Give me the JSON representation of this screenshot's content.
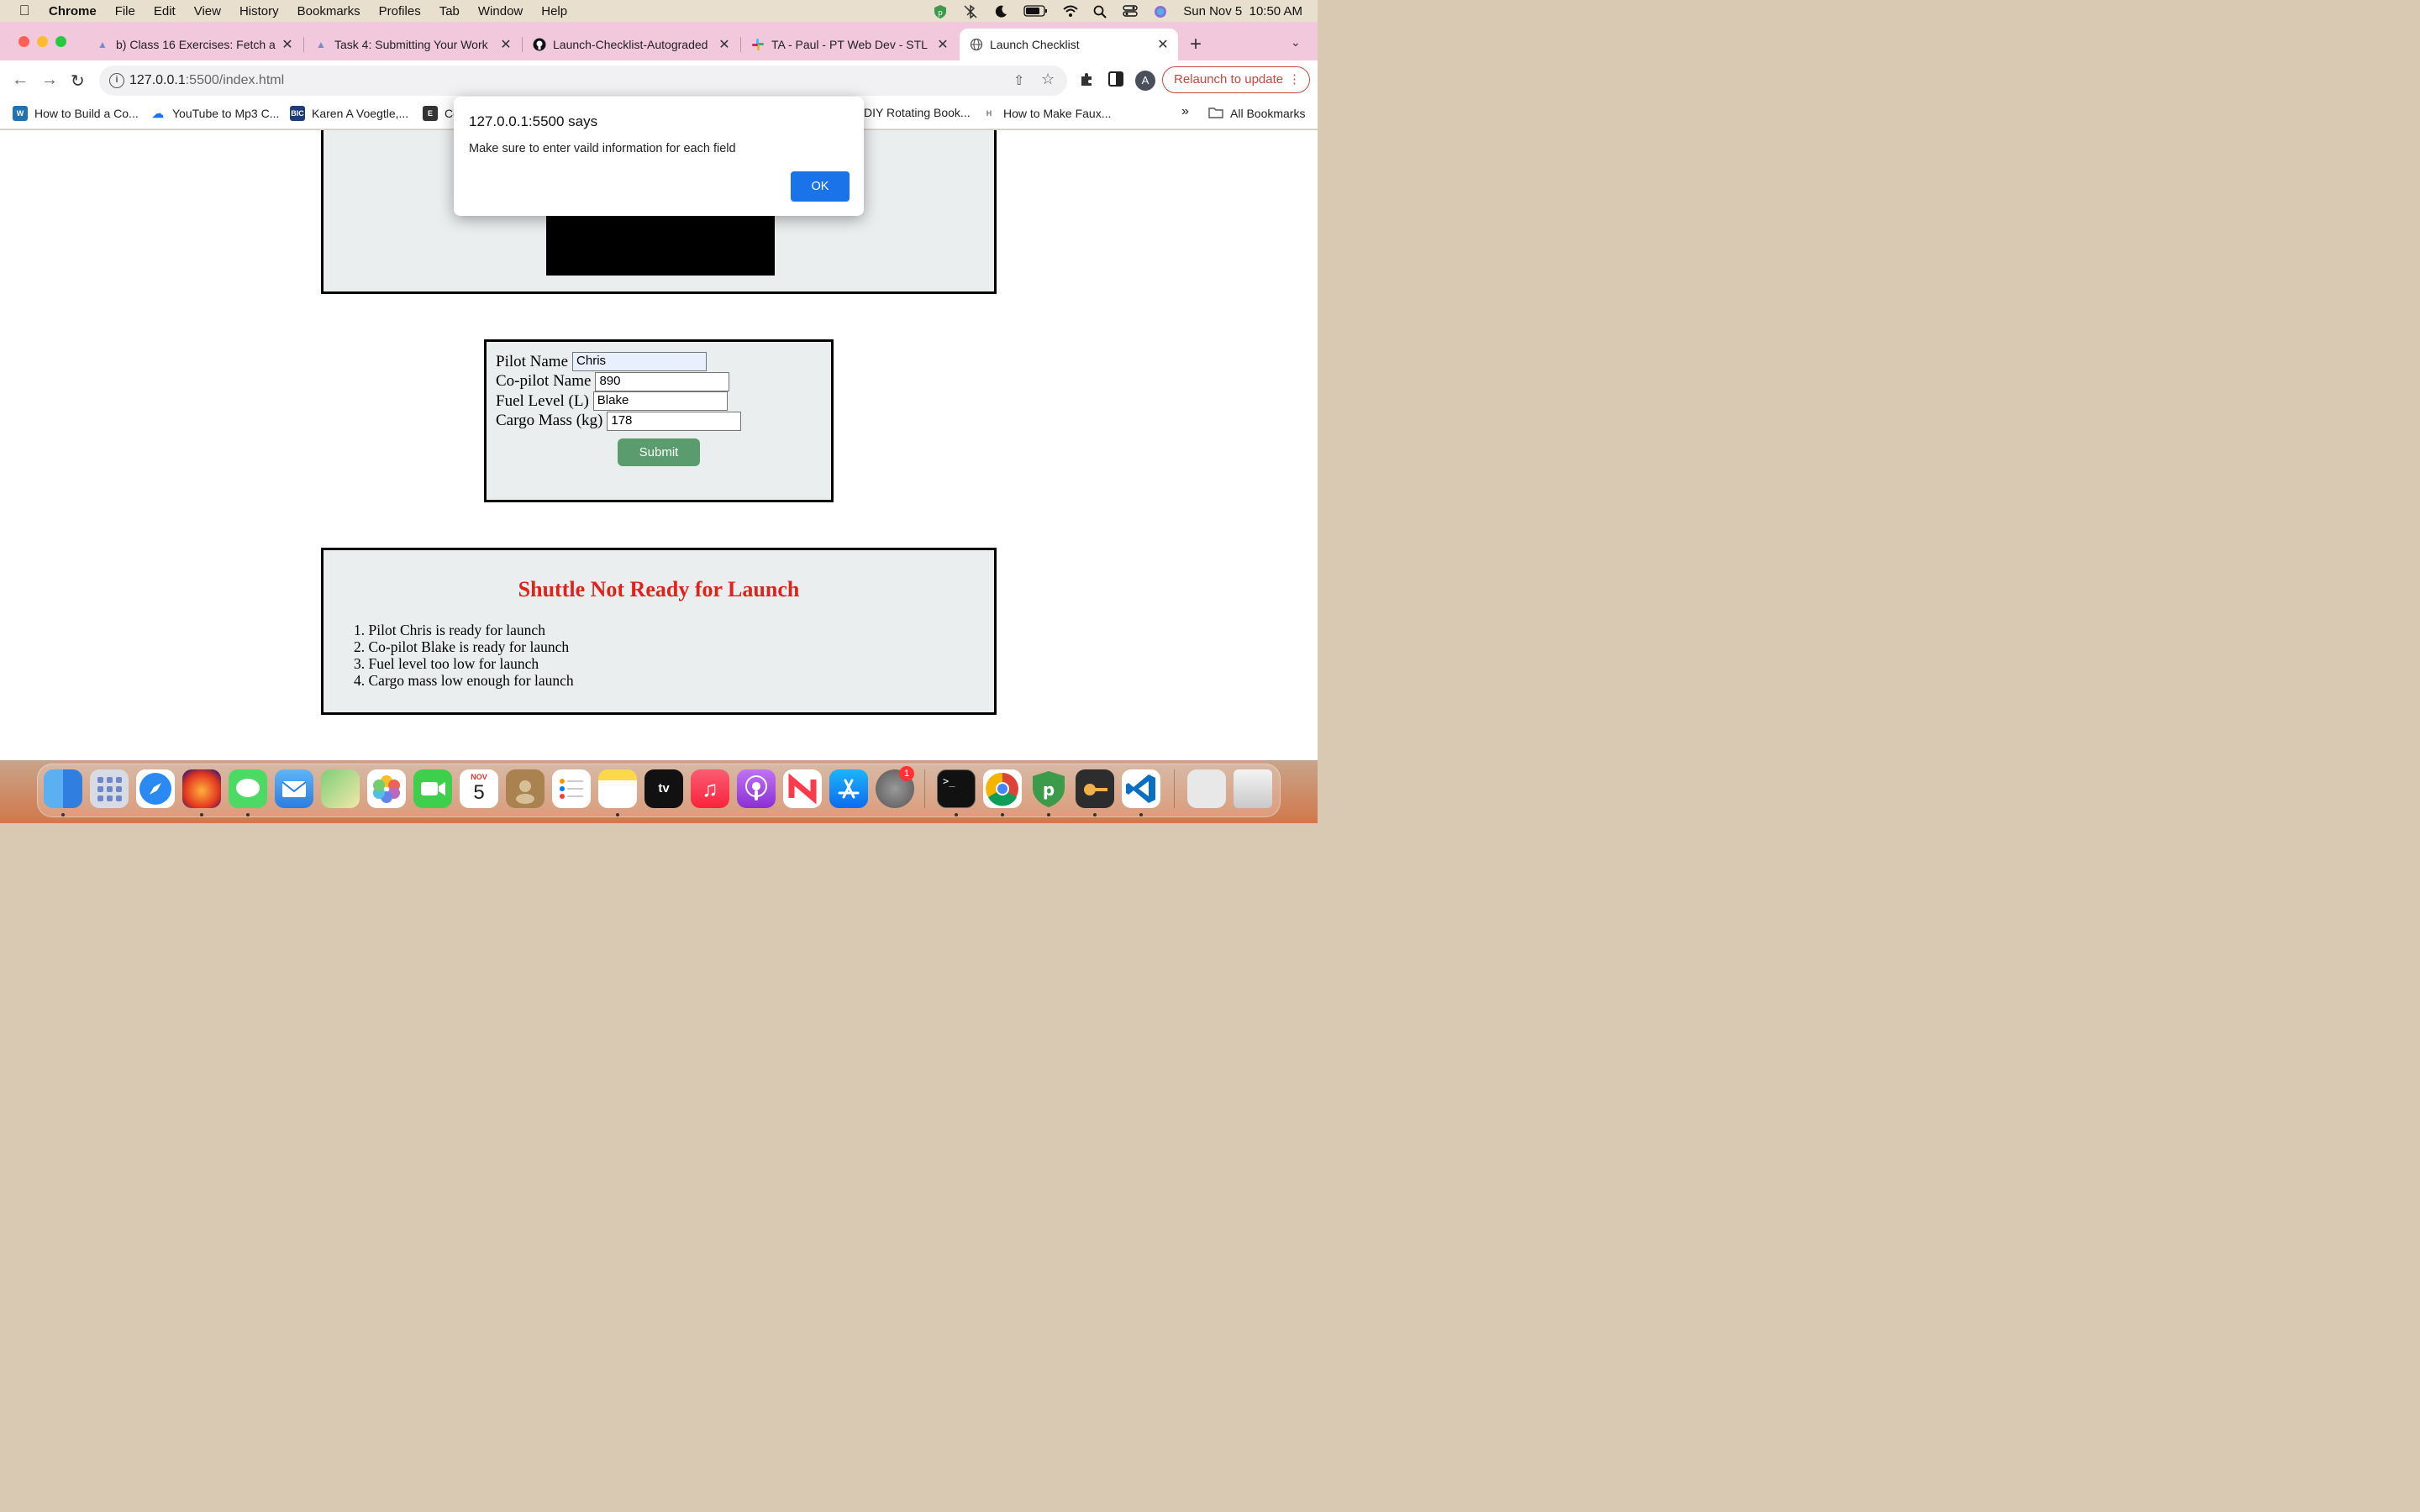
{
  "menubar": {
    "app": "Chrome",
    "items": [
      "File",
      "Edit",
      "View",
      "History",
      "Bookmarks",
      "Profiles",
      "Tab",
      "Window",
      "Help"
    ],
    "clock": "Sun Nov 5  10:50 AM"
  },
  "tabs": [
    {
      "title": "b) Class 16 Exercises: Fetch ar",
      "icon": "launchcode-icon"
    },
    {
      "title": "Task 4: Submitting Your Work",
      "icon": "launchcode-icon"
    },
    {
      "title": "Launch-Checklist-Autograded",
      "icon": "github-icon"
    },
    {
      "title": "TA - Paul - PT Web Dev - STL",
      "icon": "slack-icon"
    },
    {
      "title": "Launch Checklist",
      "icon": "globe-icon"
    }
  ],
  "toolbar": {
    "url_host": "127.0.0.1",
    "url_path": ":5500/index.html",
    "profile_initial": "A",
    "relaunch_label": "Relaunch to update"
  },
  "bookmarks": {
    "items": [
      "How to Build a Co...",
      "YouTube to Mp3 C...",
      "Karen A Voegtle,...",
      "Co",
      "DIY Rotating Book...",
      "How to Make Faux..."
    ],
    "overflow": "»",
    "all_label": "All Bookmarks"
  },
  "alert": {
    "title": "127.0.0.1:5500 says",
    "message": "Make sure to enter vaild information for each field",
    "ok_label": "OK"
  },
  "form": {
    "fields": [
      {
        "label": "Pilot Name",
        "value": "Chris"
      },
      {
        "label": "Co-pilot Name",
        "value": "890"
      },
      {
        "label": "Fuel Level (L)",
        "value": "Blake"
      },
      {
        "label": "Cargo Mass (kg)",
        "value": "178"
      }
    ],
    "submit_label": "Submit"
  },
  "status": {
    "title": "Shuttle Not Ready for Launch",
    "items": [
      "1. Pilot Chris is ready for launch",
      "2. Co-pilot Blake is ready for launch",
      "3. Fuel level too low for launch",
      "4. Cargo mass low enough for launch"
    ]
  },
  "dock": {
    "calendar_month": "NOV",
    "calendar_day": "5",
    "settings_badge": "1"
  }
}
